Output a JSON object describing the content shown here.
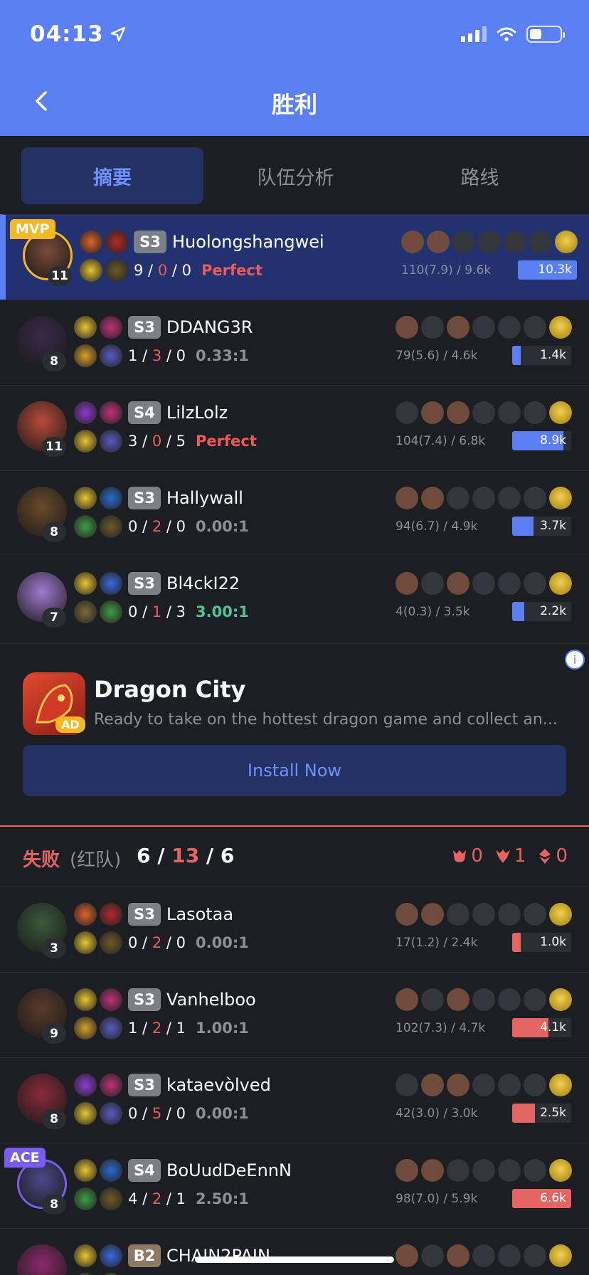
{
  "status_bar": {
    "time": "04:13"
  },
  "nav": {
    "title": "胜利"
  },
  "tabs": [
    {
      "label": "摘要",
      "active": true
    },
    {
      "label": "队伍分析",
      "active": false
    },
    {
      "label": "路线",
      "active": false
    }
  ],
  "players_top": [
    {
      "name": "Huolongshangwei",
      "rank": "S3",
      "level": "11",
      "k": "9",
      "d": "0",
      "a": "0",
      "ratio": "Perfect",
      "ratio_style": "perf",
      "cs": "110(7.9) / 9.6k",
      "damage": "10.3k",
      "damage_pct": 100,
      "tag": "MVP"
    },
    {
      "name": "DDANG3R",
      "rank": "S3",
      "level": "8",
      "k": "1",
      "d": "3",
      "a": "0",
      "ratio": "0.33:1",
      "ratio_style": "",
      "cs": "79(5.6) / 4.6k",
      "damage": "1.4k",
      "damage_pct": 14
    },
    {
      "name": "LilzLolz",
      "rank": "S4",
      "level": "11",
      "k": "3",
      "d": "0",
      "a": "5",
      "ratio": "Perfect",
      "ratio_style": "perf",
      "cs": "104(7.4) / 6.8k",
      "damage": "8.9k",
      "damage_pct": 87
    },
    {
      "name": "Hallywall",
      "rank": "S3",
      "level": "8",
      "k": "0",
      "d": "2",
      "a": "0",
      "ratio": "0.00:1",
      "ratio_style": "",
      "cs": "94(6.7) / 4.9k",
      "damage": "3.7k",
      "damage_pct": 36
    },
    {
      "name": "Bl4ckI22",
      "rank": "S3",
      "level": "7",
      "k": "0",
      "d": "1",
      "a": "3",
      "ratio": "3.00:1",
      "ratio_style": "good",
      "cs": "4(0.3) / 3.5k",
      "damage": "2.2k",
      "damage_pct": 21
    }
  ],
  "ad": {
    "badge": "AD",
    "title": "Dragon City",
    "description": "Ready to take on the hottest dragon game and collect an...",
    "button": "Install Now",
    "info": "i"
  },
  "team_red": {
    "result": "失败",
    "side": "(红队)",
    "k": "6",
    "d": "13",
    "a": "6",
    "objectives": [
      "0",
      "1",
      "0"
    ]
  },
  "players_bottom": [
    {
      "name": "Lasotaa",
      "rank": "S3",
      "level": "3",
      "k": "0",
      "d": "2",
      "a": "0",
      "ratio": "0.00:1",
      "ratio_style": "",
      "cs": "17(1.2) / 2.4k",
      "damage": "1.0k",
      "damage_pct": 15
    },
    {
      "name": "Vanhelboo",
      "rank": "S3",
      "level": "9",
      "k": "1",
      "d": "2",
      "a": "1",
      "ratio": "1.00:1",
      "ratio_style": "",
      "cs": "102(7.3) / 4.7k",
      "damage": "4.1k",
      "damage_pct": 62
    },
    {
      "name": "kataevòlved",
      "rank": "S3",
      "level": "8",
      "k": "0",
      "d": "5",
      "a": "0",
      "ratio": "0.00:1",
      "ratio_style": "",
      "cs": "42(3.0) / 3.0k",
      "damage": "2.5k",
      "damage_pct": 38
    },
    {
      "name": "BoUudDeEnnN",
      "rank": "S4",
      "level": "8",
      "k": "4",
      "d": "2",
      "a": "1",
      "ratio": "2.50:1",
      "ratio_style": "",
      "cs": "98(7.0) / 5.9k",
      "damage": "6.6k",
      "damage_pct": 100,
      "tag": "ACE"
    },
    {
      "name": "CHAIN2PAIN",
      "rank": "B2",
      "level": "",
      "k": "",
      "d": "",
      "a": "",
      "ratio": "",
      "ratio_style": "",
      "cs": "",
      "damage": "",
      "damage_pct": 0
    }
  ]
}
